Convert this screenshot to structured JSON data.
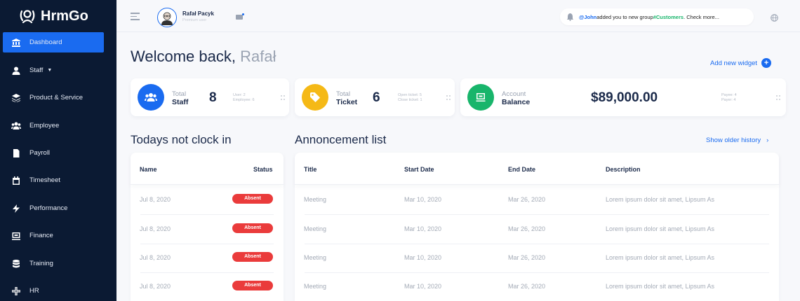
{
  "app": {
    "name": "HrmGo"
  },
  "sidebar": {
    "items": [
      {
        "label": "Dashboard",
        "icon": "bank-icon",
        "active": true
      },
      {
        "label": "Staff",
        "icon": "user-icon",
        "has_caret": true
      },
      {
        "label": "Product & Service",
        "icon": "layers-icon"
      },
      {
        "label": "Employee",
        "icon": "users-icon"
      },
      {
        "label": "Payroll",
        "icon": "file-icon"
      },
      {
        "label": "Timesheet",
        "icon": "calendar-icon"
      },
      {
        "label": "Performance",
        "icon": "bolt-icon"
      },
      {
        "label": "Finance",
        "icon": "wallet-icon"
      },
      {
        "label": "Training",
        "icon": "database-icon"
      },
      {
        "label": "HR",
        "icon": "arrows-icon"
      }
    ]
  },
  "topbar": {
    "user_name": "Rafał Pacyk",
    "user_role": "Premium user",
    "notification": {
      "mention": "@John",
      "text": " added you to new group ",
      "tag": "#Customers",
      "suffix": ". Check more..."
    }
  },
  "welcome": {
    "prefix": "Welcome back, ",
    "name": "Rafał"
  },
  "add_widget": "Add new widget",
  "cards": {
    "staff": {
      "label1": "Total",
      "label2": "Staff",
      "value": "8",
      "detail1": "User: 2",
      "detail2": "Employee: 6"
    },
    "ticket": {
      "label1": "Total",
      "label2": "Ticket",
      "value": "6",
      "detail1": "Open ticket: 5",
      "detail2": "Close ticket: 1"
    },
    "balance": {
      "label1": "Account",
      "label2": "Balance",
      "value": "$89,000.00",
      "detail1": "Payee: 4",
      "detail2": "Payer: 4"
    }
  },
  "clockin": {
    "title": "Todays not clock in",
    "headers": {
      "name": "Name",
      "status": "Status"
    },
    "rows": [
      {
        "date": "Jul 8, 2020",
        "status": "Absent"
      },
      {
        "date": "Jul 8, 2020",
        "status": "Absent"
      },
      {
        "date": "Jul 8, 2020",
        "status": "Absent"
      },
      {
        "date": "Jul 8, 2020",
        "status": "Absent"
      }
    ]
  },
  "announcements": {
    "title": "Annoncement list",
    "older_link": "Show older history",
    "headers": {
      "title": "Title",
      "start": "Start Date",
      "end": "End Date",
      "description": "Description"
    },
    "rows": [
      {
        "title": "Meeting",
        "start": "Mar 10, 2020",
        "end": "Mar 26, 2020",
        "description": "Lorem ipsum dolor sit amet, Lipsum As"
      },
      {
        "title": "Meeting",
        "start": "Mar 10, 2020",
        "end": "Mar 26, 2020",
        "description": "Lorem ipsum dolor sit amet, Lipsum As"
      },
      {
        "title": "Meeting",
        "start": "Mar 10, 2020",
        "end": "Mar 26, 2020",
        "description": "Lorem ipsum dolor sit amet, Lipsum As"
      },
      {
        "title": "Meeting",
        "start": "Mar 10, 2020",
        "end": "Mar 26, 2020",
        "description": "Lorem ipsum dolor sit amet, Lipsum As"
      }
    ]
  },
  "colors": {
    "sidebar_bg": "#0b1a33",
    "accent": "#1a6bf0",
    "staff": "#1a6bf0",
    "ticket": "#f5b916",
    "balance": "#18b56b",
    "absent": "#ea3b3b"
  }
}
